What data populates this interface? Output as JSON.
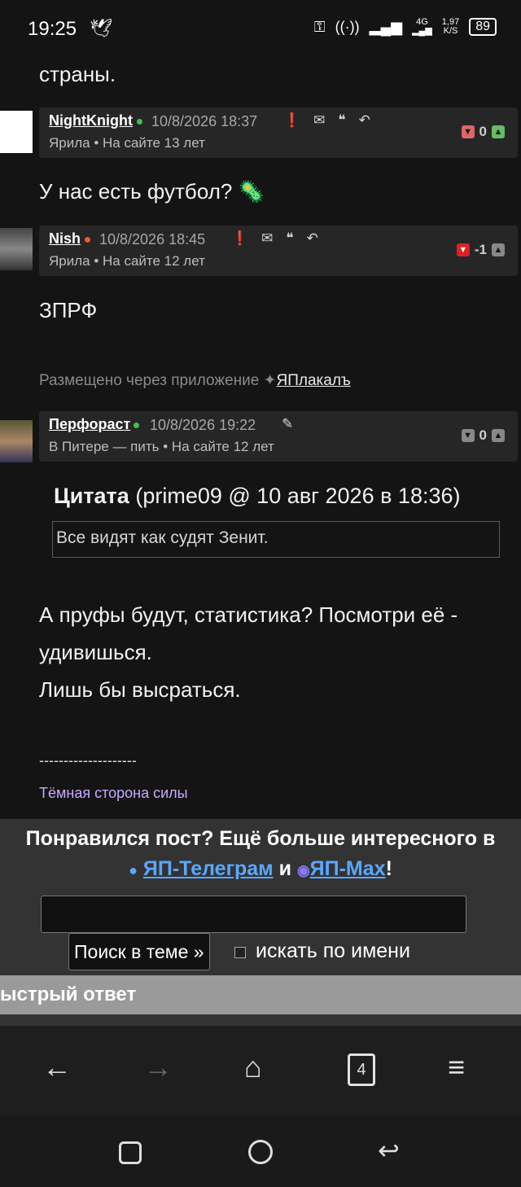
{
  "status_bar": {
    "time": "19:25",
    "bird_icon": "bird-icon",
    "net_speed_value": "1,97",
    "net_speed_unit": "K/S",
    "network_type": "4G",
    "battery": "89"
  },
  "post_fragment": "страны.",
  "comments": [
    {
      "author": "NightKnight",
      "status_color": "#3fbf4f",
      "date": "10/8/2026 18:37",
      "subline": "Ярила  •  На сайте 13 лет",
      "rating": "0",
      "body": "У нас есть футбол? 🦠"
    },
    {
      "author": "Nish",
      "status_color": "#f0582a",
      "date": "10/8/2026 18:45",
      "subline": "Ярила  •  На сайте 12 лет",
      "rating": "-1",
      "body": "ЗПРФ",
      "posted_via": "Размещено через приложение",
      "app_name": "ЯПлакалъ"
    },
    {
      "author": "Перфораст",
      "status_color": "#3fbf4f",
      "date": "10/8/2026 19:22",
      "subline": "В Питере — пить  •  На сайте 12 лет",
      "rating": "0",
      "quote_label": "Цитата",
      "quote_meta": "(prime09 @ 10 авг 2026 в 18:36)",
      "quote_text": "Все видят как судят Зенит.",
      "body_lines": [
        "А пруфы будут, статистика? Посмотри её -",
        "удивишься.",
        "Лишь бы высраться."
      ],
      "signature_separator": "--------------------",
      "signature": "Тёмная сторона силы"
    }
  ],
  "promo": {
    "line1": "Понравился пост? Ещё больше интересного в",
    "telegram_link": "ЯП-Телеграм",
    "and": "и",
    "max_link": "ЯП-Max",
    "exclaim": "!"
  },
  "search": {
    "button": "Поиск в теме »",
    "checkbox_label": "искать по имени"
  },
  "quick_reply": "ыстрый ответ",
  "browser_nav": {
    "tabs_count": "4"
  }
}
